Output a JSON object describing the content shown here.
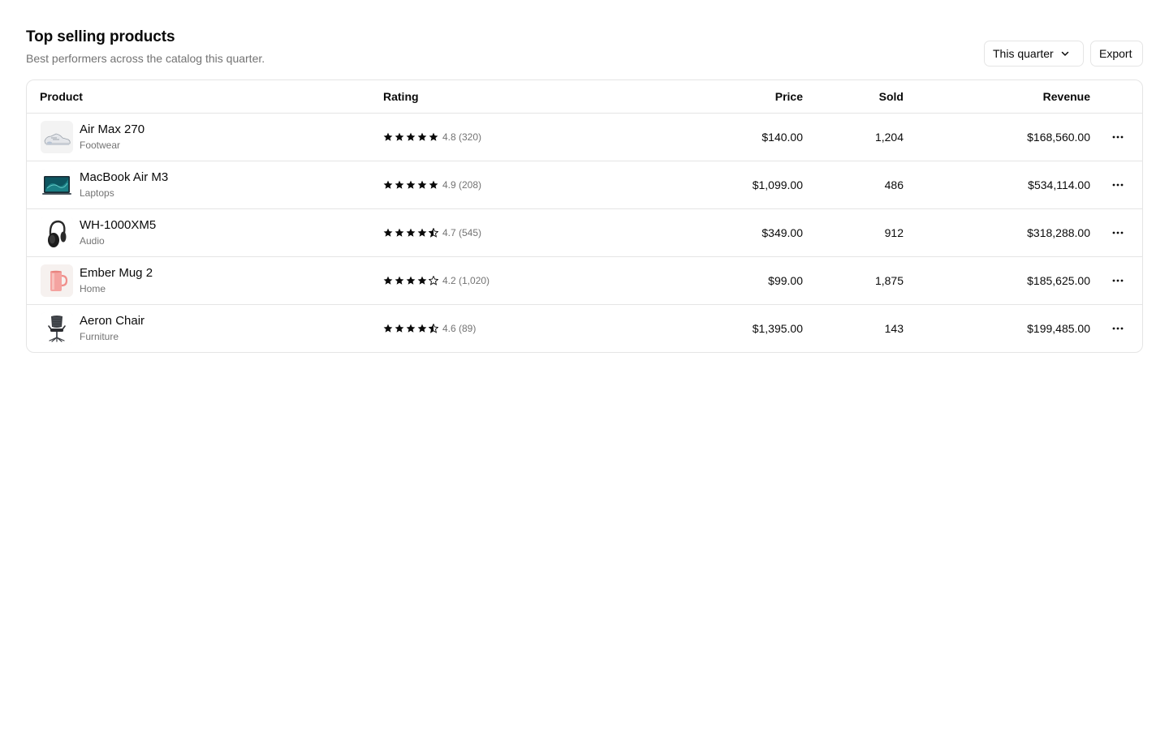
{
  "header": {
    "title": "Top selling products",
    "subtitle": "Best performers across the catalog this quarter.",
    "period_label": "This quarter",
    "export_label": "Export"
  },
  "table": {
    "columns": {
      "product": "Product",
      "rating": "Rating",
      "price": "Price",
      "sold": "Sold",
      "revenue": "Revenue"
    },
    "rows": [
      {
        "name": "Air Max 270",
        "category": "Footwear",
        "rating": 4.8,
        "rating_text": "4.8 (320)",
        "price": "$140.00",
        "sold": "1,204",
        "revenue": "$168,560.00",
        "icon": "sneaker-thumbnail"
      },
      {
        "name": "MacBook Air M3",
        "category": "Laptops",
        "rating": 4.9,
        "rating_text": "4.9 (208)",
        "price": "$1,099.00",
        "sold": "486",
        "revenue": "$534,114.00",
        "icon": "laptop-thumbnail"
      },
      {
        "name": "WH-1000XM5",
        "category": "Audio",
        "rating": 4.7,
        "rating_text": "4.7 (545)",
        "price": "$349.00",
        "sold": "912",
        "revenue": "$318,288.00",
        "icon": "headphones-thumbnail"
      },
      {
        "name": "Ember Mug 2",
        "category": "Home",
        "rating": 4.2,
        "rating_text": "4.2 (1,020)",
        "price": "$99.00",
        "sold": "1,875",
        "revenue": "$185,625.00",
        "icon": "mug-thumbnail"
      },
      {
        "name": "Aeron Chair",
        "category": "Furniture",
        "rating": 4.6,
        "rating_text": "4.6 (89)",
        "price": "$1,395.00",
        "sold": "143",
        "revenue": "$199,485.00",
        "icon": "chair-thumbnail"
      }
    ]
  },
  "colors": {
    "text": "#0a0a0a",
    "muted": "#737373",
    "border": "#e5e5e5",
    "star": "#0a0a0a"
  }
}
